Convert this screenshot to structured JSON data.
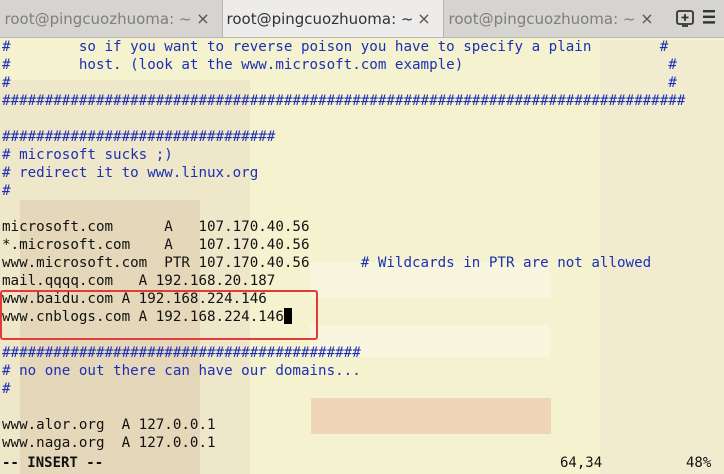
{
  "tabs": [
    {
      "title": "root@pingcuozhuoma: ~",
      "active": false
    },
    {
      "title": "root@pingcuozhuoma: ~",
      "active": true
    },
    {
      "title": "root@pingcuozhuoma: ~",
      "active": false
    }
  ],
  "icons": {
    "close": "×",
    "new_tab": "new-tab-icon",
    "menu": "menu-icon"
  },
  "lines": [
    {
      "parts": [
        {
          "text": "#        so if you want to reverse poison you have to specify a plain        #",
          "color": "blue"
        }
      ]
    },
    {
      "parts": [
        {
          "text": "#        host. (look at the www.microsoft.com example)                        #",
          "color": "blue"
        }
      ]
    },
    {
      "parts": [
        {
          "text": "#                                                                             #",
          "color": "blue"
        }
      ]
    },
    {
      "parts": [
        {
          "text": "################################################################################",
          "color": "blue"
        }
      ]
    },
    {
      "parts": [
        {
          "text": "",
          "color": "blue"
        }
      ]
    },
    {
      "parts": [
        {
          "text": "################################",
          "color": "blue"
        }
      ]
    },
    {
      "parts": [
        {
          "text": "# microsoft sucks ;)",
          "color": "blue"
        }
      ]
    },
    {
      "parts": [
        {
          "text": "# redirect it to www.linux.org",
          "color": "blue"
        }
      ]
    },
    {
      "parts": [
        {
          "text": "#",
          "color": "blue"
        }
      ]
    },
    {
      "parts": [
        {
          "text": "",
          "color": "blue"
        }
      ]
    },
    {
      "parts": [
        {
          "text": "microsoft.com      A   107.170.40.56",
          "color": "black"
        }
      ]
    },
    {
      "parts": [
        {
          "text": "*.microsoft.com    A   107.170.40.56",
          "color": "black"
        }
      ]
    },
    {
      "parts": [
        {
          "text": "www.microsoft.com  PTR 107.170.40.56",
          "color": "black"
        },
        {
          "text": "      # Wildcards in PTR are not allowed",
          "color": "blue"
        }
      ]
    },
    {
      "parts": [
        {
          "text": "mail.qqqq.com   A 192.168.20.187",
          "color": "black"
        }
      ]
    },
    {
      "parts": [
        {
          "text": "www.baidu.com A 192.168.224.146",
          "color": "black"
        }
      ]
    },
    {
      "parts": [
        {
          "text": "www.cnblogs.com A 192.168.224.146",
          "color": "black"
        }
      ],
      "cursor": true
    },
    {
      "parts": [
        {
          "text": "",
          "color": "black"
        }
      ]
    },
    {
      "parts": [
        {
          "text": "##########################################",
          "color": "blue"
        }
      ]
    },
    {
      "parts": [
        {
          "text": "# no one out there can have our domains...",
          "color": "blue"
        }
      ]
    },
    {
      "parts": [
        {
          "text": "#",
          "color": "blue"
        }
      ]
    },
    {
      "parts": [
        {
          "text": "",
          "color": "black"
        }
      ]
    },
    {
      "parts": [
        {
          "text": "www.alor.org  A 127.0.0.1",
          "color": "black"
        }
      ]
    },
    {
      "parts": [
        {
          "text": "www.naga.org  A 127.0.0.1",
          "color": "black"
        }
      ]
    }
  ],
  "status": {
    "mode": "-- INSERT --",
    "position": "64,34",
    "percent": "48%"
  },
  "colors": {
    "comment": "#1c2fb5",
    "text": "#111111",
    "terminal_bg": "#f5f2cf",
    "highlight_box": "#e53935"
  }
}
